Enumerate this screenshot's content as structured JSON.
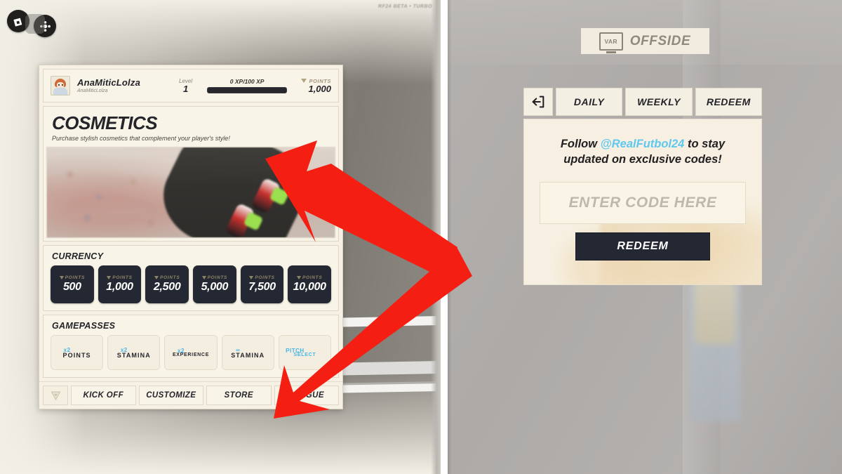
{
  "left_pane": {
    "beta_tag": "RF24 BETA • TURBO",
    "top_icons": [
      {
        "name": "roblox-logo-icon",
        "glyph": "◆"
      },
      {
        "name": "roblox-menu-icon",
        "glyph": "✛"
      }
    ],
    "profile": {
      "display_name": "AnaMiticLolza",
      "username": "AnaMiticLolza",
      "level_label": "Level",
      "level_value": "1",
      "xp_text": "0 XP/100 XP",
      "xp_percent": 0,
      "points_label": "POINTS",
      "points_value": "1,000"
    },
    "hero": {
      "title": "COSMETICS",
      "subtitle": "Purchase stylish cosmetics that complement your player's style!"
    },
    "currency": {
      "section_title": "CURRENCY",
      "items": [
        {
          "label": "POINTS",
          "amount": "500"
        },
        {
          "label": "POINTS",
          "amount": "1,000"
        },
        {
          "label": "POINTS",
          "amount": "2,500"
        },
        {
          "label": "POINTS",
          "amount": "5,000"
        },
        {
          "label": "POINTS",
          "amount": "7,500"
        },
        {
          "label": "POINTS",
          "amount": "10,000"
        }
      ]
    },
    "gamepasses": {
      "section_title": "GAMEPASSES",
      "items": [
        {
          "multiplier": "x2",
          "name": "POINTS",
          "small": false
        },
        {
          "multiplier": "x2",
          "name": "STAMINA",
          "small": false
        },
        {
          "multiplier": "x2",
          "name": "EXPERIENCE",
          "small": true
        },
        {
          "multiplier": "∞",
          "name": "STAMINA",
          "small": false
        },
        {
          "multiplier": "PITCH",
          "name": "SELECT",
          "small": true
        }
      ]
    },
    "bottom_nav": {
      "logo_name": "game-logo-icon",
      "items": [
        {
          "label": "KICK OFF"
        },
        {
          "label": "CUSTOMIZE"
        },
        {
          "label": "STORE"
        },
        {
          "label": "LEAGUE"
        }
      ]
    }
  },
  "right_pane": {
    "var_banner": {
      "icon_text": "VAR",
      "word": "OFFSIDE"
    },
    "tabs": {
      "exit_icon": "exit-door-icon",
      "items": [
        {
          "label": "DAILY"
        },
        {
          "label": "WEEKLY"
        },
        {
          "label": "REDEEM"
        }
      ]
    },
    "codes": {
      "follow_prefix": "Follow ",
      "handle": "@RealFutbol24",
      "follow_suffix": " to stay",
      "follow_line2": "updated on exclusive codes!",
      "input_placeholder": "ENTER CODE HERE",
      "input_value": "",
      "redeem_label": "REDEEM"
    }
  },
  "annotations": {
    "arrow_color": "#f41f12",
    "arrow_count": 2,
    "arrow_targets": [
      "cosmetics-hero-banner",
      "store-nav-button"
    ]
  },
  "colors": {
    "panel_cream": "#f6f1e4",
    "chip_dark": "#242833",
    "accent_blue": "#5ec8ef",
    "gold_label": "#8e8365",
    "arrow_red": "#f41f12"
  }
}
